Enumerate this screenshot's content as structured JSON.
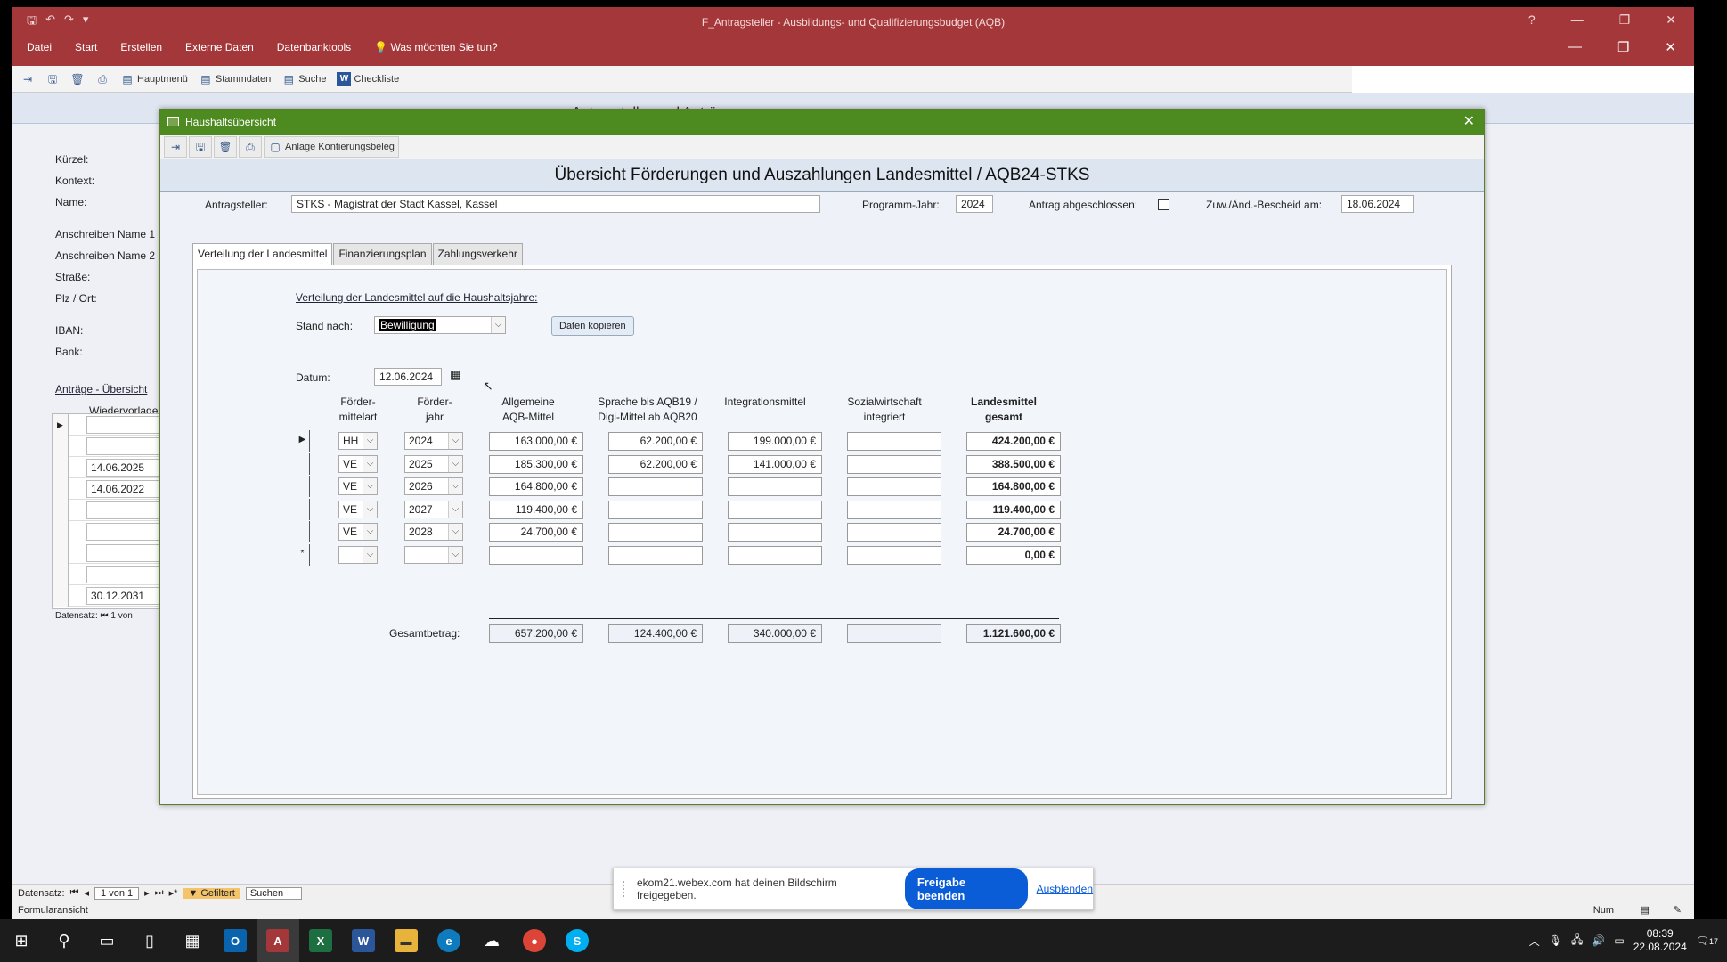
{
  "app": {
    "title": "F_Antragsteller - Ausbildungs- und Qualifizierungsbudget (AQB)",
    "help": "?",
    "menu": [
      "Datei",
      "Start",
      "Erstellen",
      "Externe Daten",
      "Datenbanktools",
      "Was möchten Sie tun?"
    ],
    "toolbar": [
      "Hauptmenü",
      "Stammdaten",
      "Suche",
      "Checkliste"
    ]
  },
  "bgform": {
    "header_title": "Antragsteller und Anträge",
    "labels": [
      "Kürzel:",
      "Kontext:",
      "Name:",
      "Anschreiben Name 1",
      "Anschreiben Name 2",
      "Straße:",
      "Plz / Ort:",
      "IBAN:",
      "Bank:"
    ],
    "link_overview": "Anträge - Übersicht",
    "col_wiedervorlage": "Wiedervorlage",
    "subrows": [
      "",
      "",
      "14.06.2025",
      "14.06.2022",
      "",
      "",
      "",
      "",
      "30.12.2031"
    ],
    "sub_nav_label": "Datensatz:",
    "sub_nav_value": "1 von"
  },
  "dialog": {
    "title": "Haushaltsübersicht",
    "tool_attach": "Anlage Kontierungsbeleg",
    "header": "Übersicht Förderungen und Auszahlungen Landesmittel / AQB24-STKS",
    "antragsteller_label": "Antragsteller:",
    "antragsteller_value": "STKS - Magistrat der Stadt Kassel, Kassel",
    "programmjahr_label": "Programm-Jahr:",
    "programmjahr_value": "2024",
    "abgeschlossen_label": "Antrag abgeschlossen:",
    "bescheid_label": "Zuw./Änd.-Bescheid am:",
    "bescheid_value": "18.06.2024",
    "tabs": [
      "Verteilung der Landesmittel",
      "Finanzierungsplan",
      "Zahlungsverkehr"
    ],
    "section_title": "Verteilung der Landesmittel auf die Haushaltsjahre:",
    "stand_label": "Stand nach:",
    "stand_value": "Bewilligung",
    "copy_button": "Daten kopieren",
    "datum_label": "Datum:",
    "datum_value": "12.06.2024",
    "columns": [
      [
        "Förder-",
        "mittelart"
      ],
      [
        "Förder-",
        "jahr"
      ],
      [
        "Allgemeine",
        "AQB-Mittel"
      ],
      [
        "Sprache bis AQB19 /",
        "Digi-Mittel ab AQB20"
      ],
      [
        "Integrationsmittel",
        ""
      ],
      [
        "Sozialwirtschaft",
        "integriert"
      ],
      [
        "Landesmittel",
        "gesamt"
      ]
    ],
    "rows": [
      {
        "sel": "▶",
        "art": "HH",
        "jahr": "2024",
        "allg": "163.000,00 €",
        "sprache": "62.200,00 €",
        "integ": "199.000,00 €",
        "sozial": "",
        "gesamt": "424.200,00 €"
      },
      {
        "sel": "",
        "art": "VE",
        "jahr": "2025",
        "allg": "185.300,00 €",
        "sprache": "62.200,00 €",
        "integ": "141.000,00 €",
        "sozial": "",
        "gesamt": "388.500,00 €"
      },
      {
        "sel": "",
        "art": "VE",
        "jahr": "2026",
        "allg": "164.800,00 €",
        "sprache": "",
        "integ": "",
        "sozial": "",
        "gesamt": "164.800,00 €"
      },
      {
        "sel": "",
        "art": "VE",
        "jahr": "2027",
        "allg": "119.400,00 €",
        "sprache": "",
        "integ": "",
        "sozial": "",
        "gesamt": "119.400,00 €"
      },
      {
        "sel": "",
        "art": "VE",
        "jahr": "2028",
        "allg": "24.700,00 €",
        "sprache": "",
        "integ": "",
        "sozial": "",
        "gesamt": "24.700,00 €"
      },
      {
        "sel": "*",
        "art": "",
        "jahr": "",
        "allg": "",
        "sprache": "",
        "integ": "",
        "sozial": "",
        "gesamt": "0,00 €"
      }
    ],
    "total_label": "Gesamtbetrag:",
    "totals": {
      "allg": "657.200,00 €",
      "sprache": "124.400,00 €",
      "integ": "340.000,00 €",
      "sozial": "",
      "gesamt": "1.121.600,00 €"
    }
  },
  "statusbar": {
    "label": "Datensatz:",
    "record": "1 von 1",
    "filter": "Gefiltert",
    "search": "Suchen",
    "view": "Formularansicht",
    "num": "Num"
  },
  "webex": {
    "message": "ekom21.webex.com hat deinen Bildschirm freigegeben.",
    "stop": "Freigabe beenden",
    "hide": "Ausblenden"
  },
  "taskbar": {
    "time": "08:39",
    "date": "22.08.2024",
    "notif": "17"
  }
}
